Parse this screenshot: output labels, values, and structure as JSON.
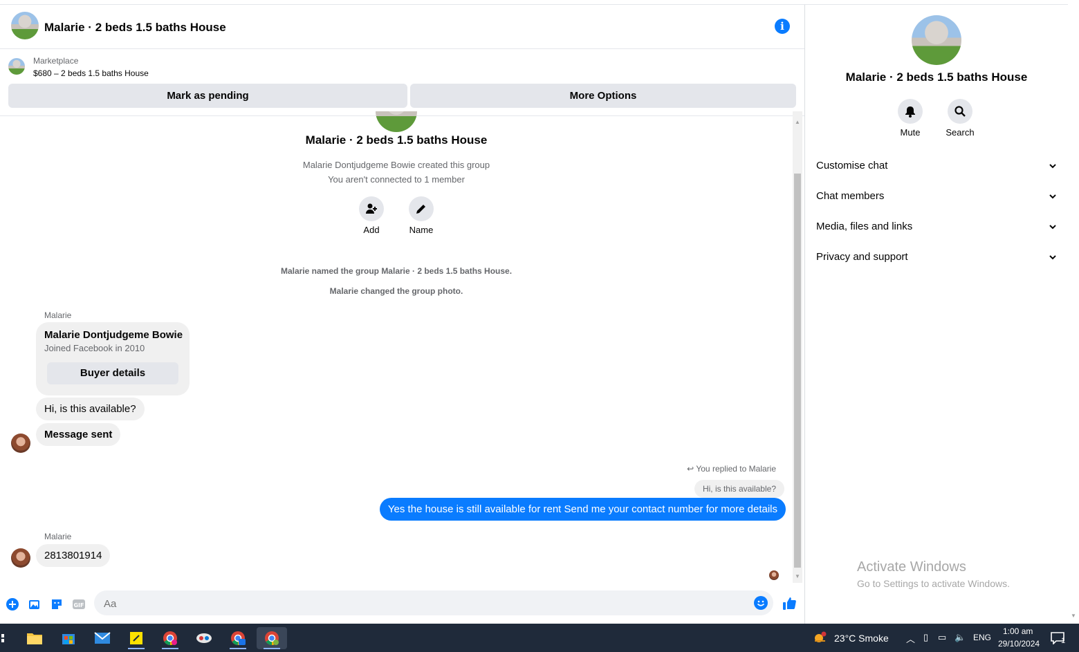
{
  "header": {
    "title": "Malarie · 2 beds 1.5 baths House"
  },
  "marketplace": {
    "label": "Marketplace",
    "listing": "$680 – 2 beds 1.5 baths House",
    "pending_button": "Mark as pending",
    "more_button": "More Options"
  },
  "group": {
    "name": "Malarie · 2 beds 1.5 baths House",
    "created_by": "Malarie Dontjudgeme Bowie created this group",
    "connection": "You aren't connected to 1 member",
    "add_label": "Add",
    "name_label": "Name"
  },
  "system_messages": [
    "Malarie named the group Malarie · 2 beds 1.5 baths House.",
    "Malarie changed the group photo."
  ],
  "messages": {
    "sender1": "Malarie",
    "card_name": "Malarie Dontjudgeme Bowie",
    "card_sub": "Joined Facebook in 2010",
    "card_button": "Buyer details",
    "msg1": "Hi, is this available?",
    "msg2": "Message sent",
    "reply_note": "You replied to Malarie",
    "quoted": "Hi, is this available?",
    "outgoing": "Yes the house is still available for rent Send me your contact number for more details",
    "sender2": "Malarie",
    "msg3": "2813801914"
  },
  "composer": {
    "placeholder": "Aa"
  },
  "panel": {
    "title": "Malarie · 2 beds 1.5 baths House",
    "mute_label": "Mute",
    "search_label": "Search",
    "sections": [
      "Customise chat",
      "Chat members",
      "Media, files and links",
      "Privacy and support"
    ]
  },
  "watermark": {
    "title": "Activate Windows",
    "sub": "Go to Settings to activate Windows."
  },
  "taskbar": {
    "weather": "23°C  Smoke",
    "lang": "ENG",
    "time": "1:00 am",
    "date": "29/10/2024",
    "notif_count": "1"
  },
  "colors": {
    "accent": "#0a7cff",
    "bubble_in": "#f0f0f0",
    "taskbar": "#1f2a3a"
  }
}
